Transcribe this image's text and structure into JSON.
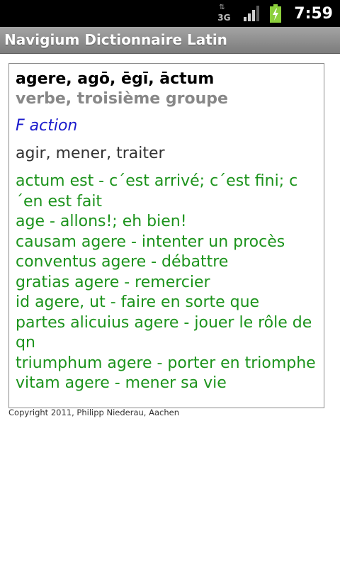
{
  "status_bar": {
    "network_label": "3G",
    "time": "7:59"
  },
  "app": {
    "title": "Navigium Dictionnaire Latin"
  },
  "entry": {
    "headword": "agere, agō, ēgī, āctum",
    "grammar": "verbe, troisième groupe",
    "category": "F action",
    "translation": "agir, mener, traiter",
    "phrases": [
      "actum est - c´est arrivé; c´est fini; c´en est fait",
      "age - allons!; eh bien!",
      "causam agere - intenter un procès",
      "conventus agere - débattre",
      "gratias agere - remercier",
      "id agere, ut - faire en sorte que",
      "partes alicuius agere - jouer le rôle de qn",
      "triumphum agere - porter en triomphe",
      "vitam agere - mener sa vie"
    ]
  },
  "footer": {
    "copyright": "Copyright 2011, Philipp Niederau, Aachen"
  },
  "colors": {
    "headword": "#000000",
    "grammar": "#888888",
    "category": "#1a1acc",
    "phrases": "#1c931c",
    "status_bar": "#000000",
    "title_bar": "#8e8e8e"
  },
  "icons": [
    "network-3g-icon",
    "signal-strength-icon",
    "battery-charging-icon"
  ]
}
